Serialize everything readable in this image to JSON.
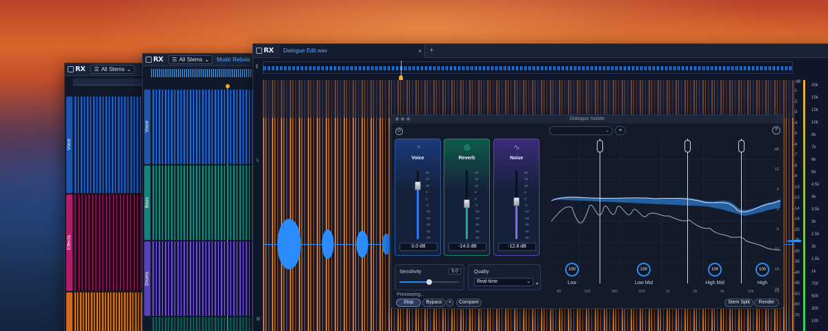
{
  "colors": {
    "accent": "#2f8df0",
    "voice": "#1f63c7",
    "reverb": "#0fa88a",
    "noise": "#8a5ad8",
    "playhead": "#f5a623"
  },
  "windows": {
    "back": {
      "logo": "RX",
      "dropdown": "All Stems",
      "stems": [
        "Voice",
        "Effects"
      ]
    },
    "middle": {
      "logo": "RX",
      "dropdown": "All Stems",
      "tab": "Music Rebala",
      "stems": [
        "Voice",
        "Bass",
        "Drums"
      ]
    },
    "main": {
      "logo": "RX",
      "tab": "Dialogue Edit.wav",
      "close_icon": "×",
      "add_tab": "+",
      "channel_left": "L",
      "channel_right": "R",
      "scale_unit": "dB",
      "right_scale_khz": [
        "20k",
        "15k",
        "12k",
        "10k",
        "8k",
        "7k",
        "6k",
        "5k",
        "4.5k",
        "4k",
        "3.5k",
        "3k",
        "2.5k",
        "2k",
        "1.5k",
        "1k",
        "700",
        "500",
        "300",
        "100"
      ],
      "right_scale_db": [
        "-1",
        "-2",
        "-3",
        "-4",
        "-5",
        "-6",
        "-7",
        "-8",
        "-9",
        "-10",
        "-12",
        "-14",
        "-16",
        "-20",
        "-25",
        "-30",
        "-35",
        "-40",
        "-45",
        "-50",
        "-60",
        "-70"
      ]
    }
  },
  "plugin": {
    "title": "Dialogue Isolate",
    "channels": [
      {
        "name": "Voice",
        "value": "0.0 dB",
        "level": 0.78
      },
      {
        "name": "Reverb",
        "value": "-14.0 dB",
        "level": 0.52
      },
      {
        "name": "Noise",
        "value": "-12.8 dB",
        "level": 0.55
      }
    ],
    "fader_scale": [
      "20",
      "15",
      "10",
      "5",
      "0",
      "-5",
      "-10",
      "-15",
      "-20",
      "-30",
      "-40",
      "-inf"
    ],
    "sensitivity": {
      "label": "Sensitivity",
      "value": "5.0",
      "level": 0.5
    },
    "quality": {
      "label": "Quality",
      "value": "Real-time"
    },
    "previewing": "Previewing...",
    "buttons": {
      "stop": "Stop",
      "bypass": "Bypass",
      "plus": "+",
      "compare": "Compare",
      "stem_split": "Stem Split",
      "render": "Render"
    },
    "help": "?",
    "eq": {
      "db_scale": [
        "dB",
        "12",
        "6",
        "0",
        "-6",
        "-12",
        "-18",
        "-24"
      ],
      "bands": [
        {
          "label": "Low",
          "value": "100"
        },
        {
          "label": "Low Mid",
          "value": "100"
        },
        {
          "label": "High Mid",
          "value": "100"
        },
        {
          "label": "High",
          "value": "100"
        }
      ],
      "freq_ticks": [
        "60",
        "100",
        "300",
        "600",
        "1k",
        "3k",
        "6k",
        "10k",
        "Hz"
      ]
    }
  }
}
